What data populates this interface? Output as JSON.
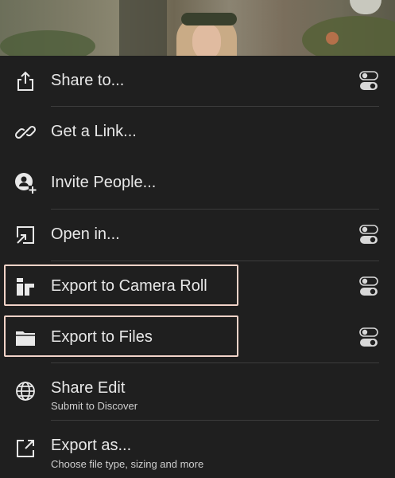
{
  "menu": {
    "items": [
      {
        "label": "Share to...",
        "icon": "share-icon",
        "has_toggle": true
      },
      {
        "label": "Get a Link...",
        "icon": "link-icon",
        "has_toggle": false
      },
      {
        "label": "Invite People...",
        "icon": "invite-people-icon",
        "has_toggle": false
      },
      {
        "label": "Open in...",
        "icon": "open-in-icon",
        "has_toggle": true
      },
      {
        "label": "Export to Camera Roll",
        "icon": "camera-roll-icon",
        "has_toggle": true,
        "highlighted": true
      },
      {
        "label": "Export to Files",
        "icon": "folder-icon",
        "has_toggle": true,
        "highlighted": true
      },
      {
        "label": "Share Edit",
        "sublabel": "Submit to Discover",
        "icon": "globe-icon",
        "has_toggle": false
      },
      {
        "label": "Export as...",
        "sublabel": "Choose file type, sizing and more",
        "icon": "export-as-icon",
        "has_toggle": false
      }
    ],
    "toggle_icon": "settings-toggle-icon"
  },
  "colors": {
    "background": "#1f1f1f",
    "text": "#e8e8e8",
    "divider": "#3c3c3c",
    "highlight_border": "#f1d3c8"
  }
}
